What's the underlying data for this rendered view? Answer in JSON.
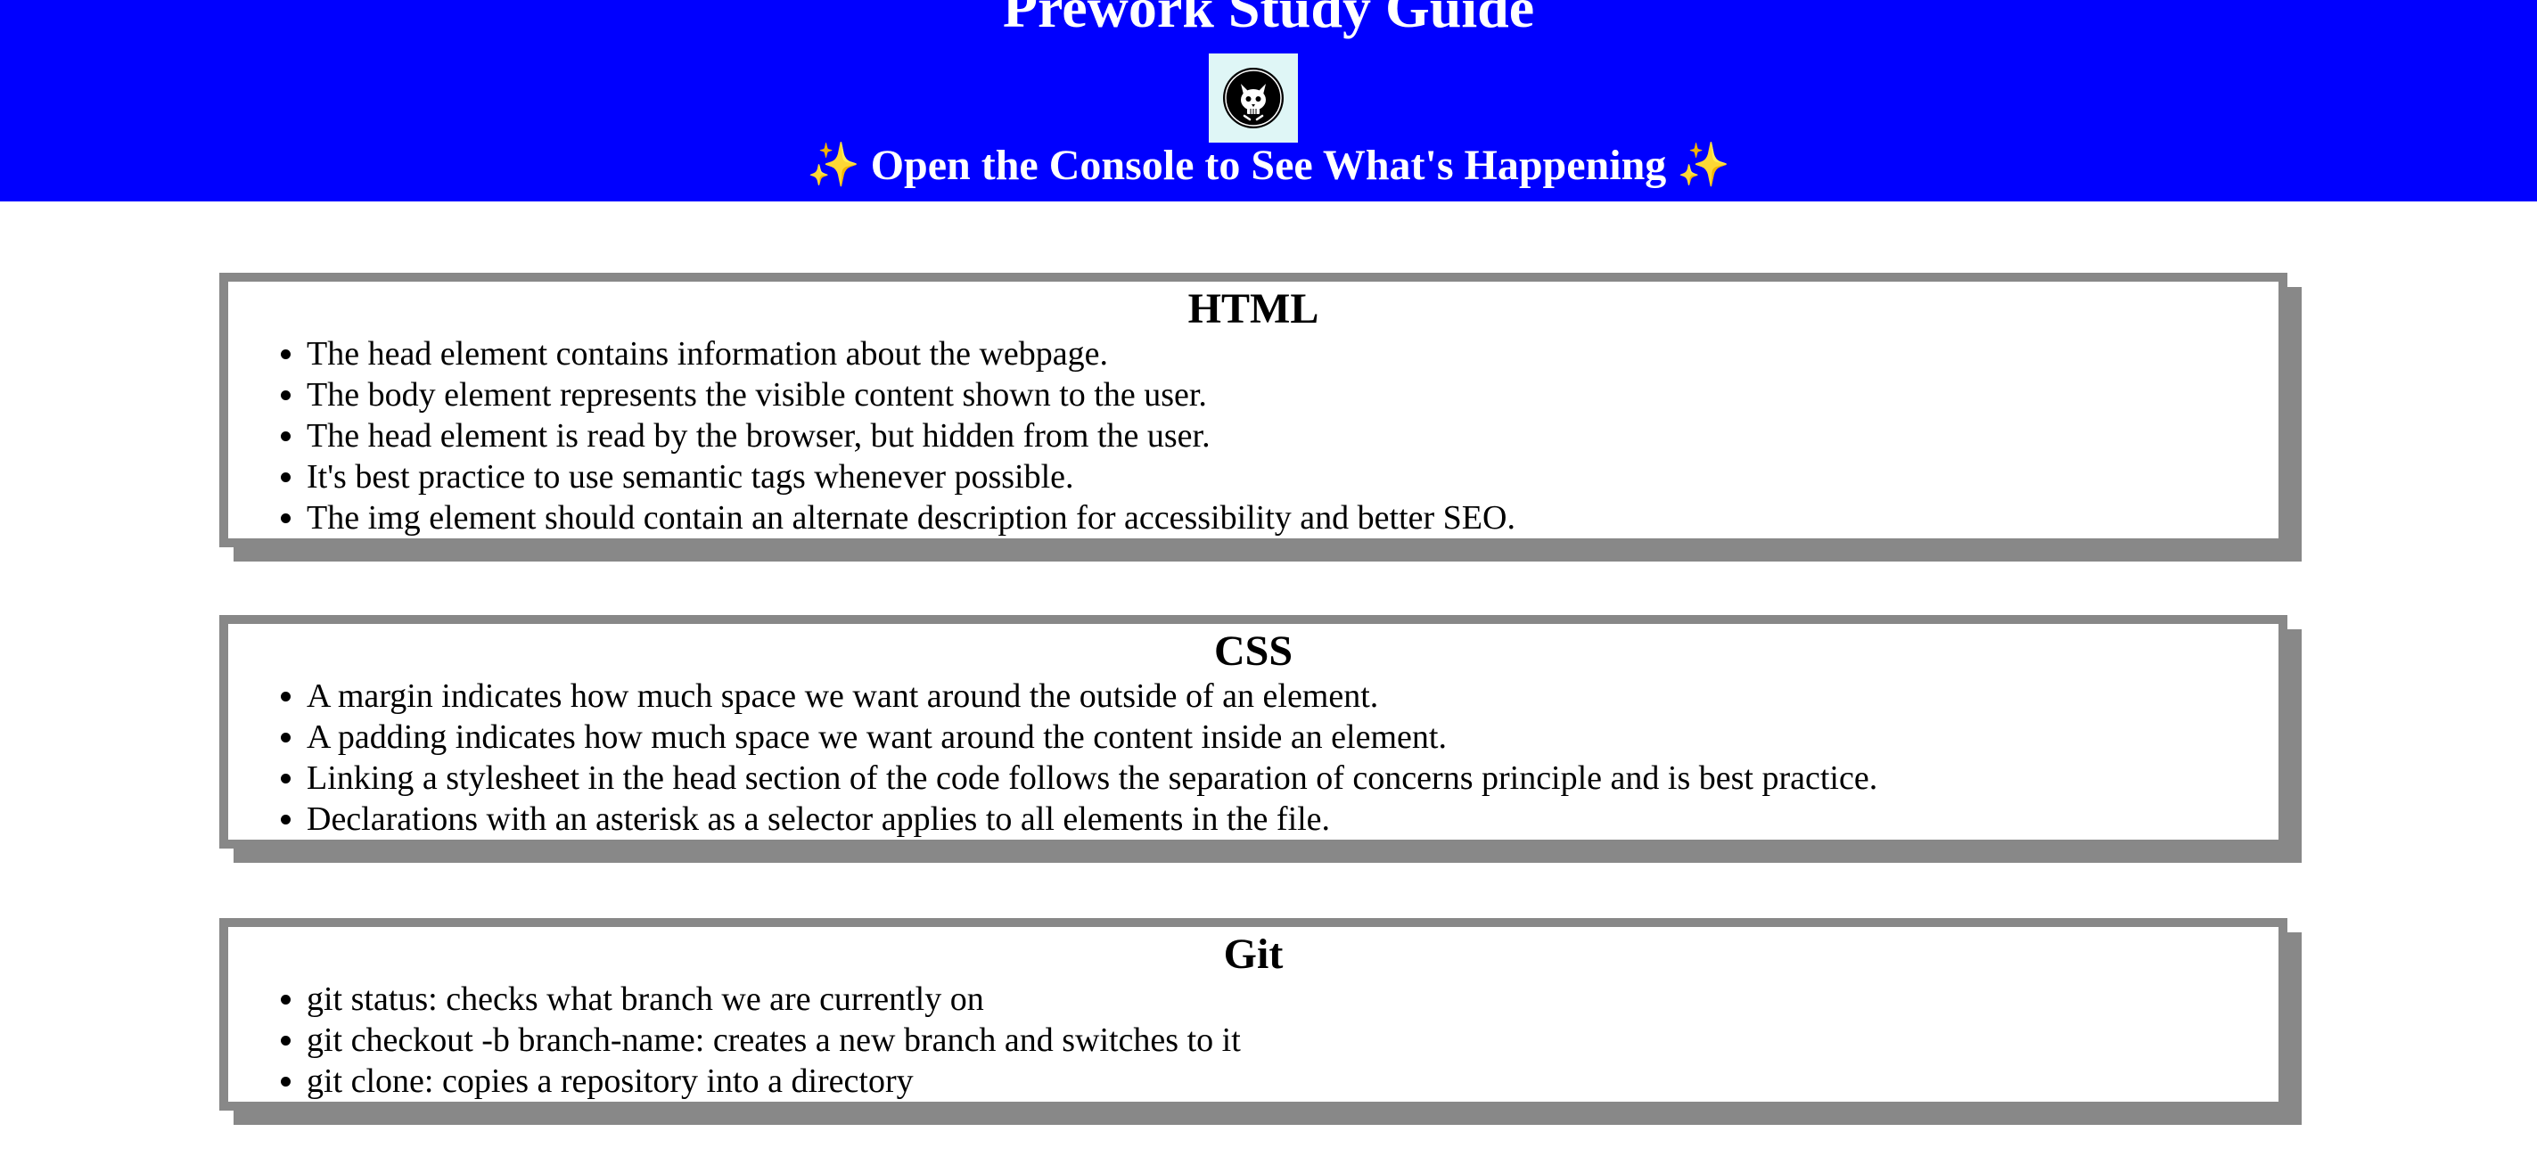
{
  "header": {
    "title": "Prework Study Guide",
    "logo_icon": "cat-skull-logo-icon",
    "subtitle": "Open the Console to See What's Happening",
    "sparkle": "✨",
    "background_color": "#0000ff"
  },
  "sections": [
    {
      "title": "HTML",
      "items": [
        "The head element contains information about the webpage.",
        "The body element represents the visible content shown to the user.",
        "The head element is read by the browser, but hidden from the user.",
        "It's best practice to use semantic tags whenever possible.",
        "The img element should contain an alternate description for accessibility and better SEO."
      ]
    },
    {
      "title": "CSS",
      "items": [
        "A margin indicates how much space we want around the outside of an element.",
        "A padding indicates how much space we want around the content inside an element.",
        "Linking a stylesheet in the head section of the code follows the separation of concerns principle and is best practice.",
        "Declarations with an asterisk as a selector applies to all elements in the file."
      ]
    },
    {
      "title": "Git",
      "items": [
        "git status: checks what branch we are currently on",
        "git checkout -b branch-name: creates a new branch and switches to it",
        "git clone: copies a repository into a directory"
      ]
    }
  ]
}
